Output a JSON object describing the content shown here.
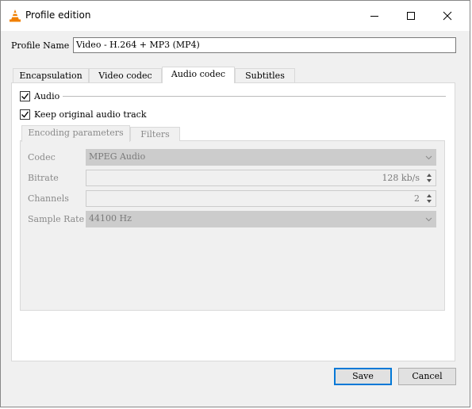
{
  "window": {
    "title": "Profile edition"
  },
  "profile": {
    "label": "Profile Name",
    "value": "Video - H.264 + MP3 (MP4)"
  },
  "tabs": [
    "Encapsulation",
    "Video codec",
    "Audio codec",
    "Subtitles"
  ],
  "audio": {
    "audio_checkbox_label": "Audio",
    "audio_checked": true,
    "keep_original_label": "Keep original audio track",
    "keep_original_checked": true
  },
  "subtabs": [
    "Encoding parameters",
    "Filters"
  ],
  "fields": {
    "codec": {
      "label": "Codec",
      "value": "MPEG Audio"
    },
    "bitrate": {
      "label": "Bitrate",
      "value": "128 kb/s"
    },
    "channels": {
      "label": "Channels",
      "value": "2"
    },
    "sample_rate": {
      "label": "Sample Rate",
      "value": "44100 Hz"
    }
  },
  "buttons": {
    "save": "Save",
    "cancel": "Cancel"
  },
  "icons": {
    "app": "vlc-cone-icon",
    "minimize": "minimize-icon",
    "maximize": "maximize-icon",
    "close": "close-icon"
  },
  "colors": {
    "accent": "#0078d7",
    "vlc_orange": "#f08000"
  }
}
